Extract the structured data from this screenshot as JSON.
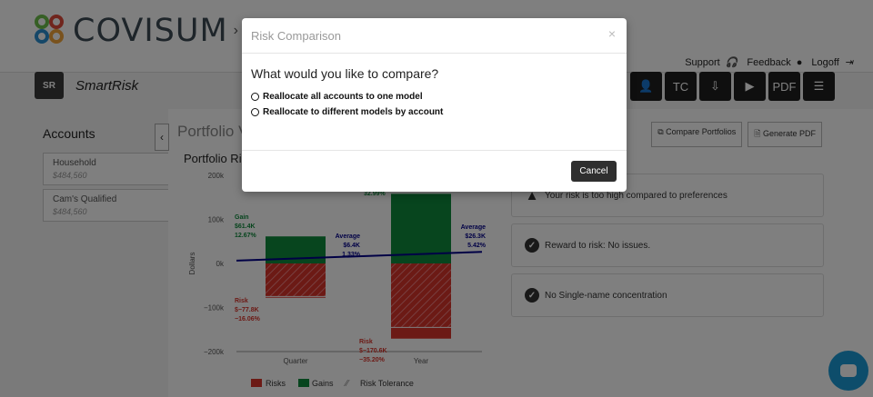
{
  "header": {
    "logo_text": "COVISUM",
    "breadcrumb_sep": "›",
    "breadcrumb_tail": "C",
    "links": [
      {
        "label": "Support",
        "icon": "headset-icon"
      },
      {
        "label": "Feedback",
        "icon": "chat-bubble-icon"
      },
      {
        "label": "Logoff",
        "icon": "logoff-icon"
      }
    ],
    "colors": {
      "logo_text": "#3d4a55"
    }
  },
  "subbar": {
    "badge": "SR",
    "app_name": "SmartRisk",
    "tool_icons": [
      "user-icon",
      "tc-icon",
      "download-icon",
      "play-icon",
      "pdf-icon",
      "document-icon"
    ]
  },
  "accounts": {
    "title": "Accounts",
    "items": [
      {
        "name": "Household",
        "value": "$484,560"
      },
      {
        "name": "Cam's Qualified",
        "value": "$484,560"
      }
    ]
  },
  "main": {
    "title": "Portfolio V",
    "chart_title": "Portfolio Ri",
    "buttons": {
      "compare": "Compare Portfolios",
      "pdf": "Generate PDF"
    }
  },
  "alerts": [
    {
      "text": "Your risk is too high compared to preferences",
      "icon": "warning-icon"
    },
    {
      "text": "Reward to risk: No issues.",
      "icon": "check-icon"
    },
    {
      "text": "No Single-name concentration",
      "icon": "check-icon"
    }
  ],
  "chart_data": {
    "type": "bar",
    "ylabel": "Dollars",
    "ylim": [
      -200000,
      200000
    ],
    "yticks": [
      "200k",
      "100k",
      "0k",
      "−100k",
      "−200k"
    ],
    "categories": [
      "Quarter",
      "Year"
    ],
    "series": [
      {
        "name": "Risks",
        "values": [
          -77800,
          -170600
        ],
        "labels": [
          "Risk\n$−77.8K\n−16.06%",
          "Risk\n$−170.6K\n−35.20%"
        ]
      },
      {
        "name": "Gains",
        "values": [
          61400,
          158000
        ],
        "labels": [
          "Gain\n$61.4K\n12.67%",
          "32.99%"
        ]
      },
      {
        "name": "Risk Tolerance",
        "values": [
          -75000,
          -145000
        ]
      }
    ],
    "averages": [
      {
        "category": "Quarter",
        "value": 6400,
        "label": "Average\n$6.4K\n1.33%"
      },
      {
        "category": "Year",
        "value": 26300,
        "label": "Average\n$26.3K\n5.42%"
      }
    ],
    "colors": {
      "risk": "#d9342b",
      "gain": "#0f8a3c",
      "average": "#00008b"
    },
    "legend": [
      "Risks",
      "Gains",
      "Risk Tolerance"
    ]
  },
  "modal": {
    "title": "Risk Comparison",
    "close": "×",
    "question": "What would you like to compare?",
    "options": [
      "Reallocate all accounts to one model",
      "Reallocate to different models by account"
    ],
    "cancel": "Cancel"
  }
}
